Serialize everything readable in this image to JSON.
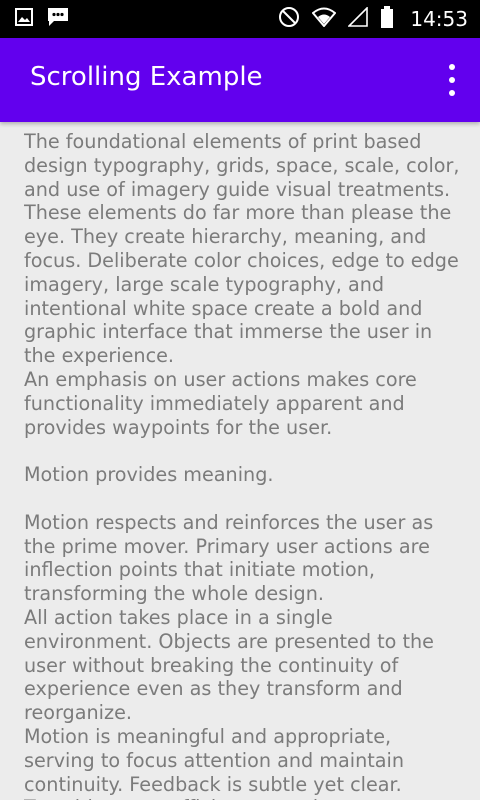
{
  "status_bar": {
    "time": "14:53",
    "left_icons": [
      "image-icon",
      "message-icon"
    ],
    "right_icons": [
      "do-not-disturb-icon",
      "wifi-icon",
      "signal-icon",
      "battery-icon"
    ]
  },
  "app_bar": {
    "title": "Scrolling Example",
    "menu_icon": "more-vert-icon",
    "background": "#6200ee"
  },
  "content": {
    "text": " The foundational elements of print based design typography, grids, space, scale, color, and use of imagery guide visual treatments. These elements do far more than please the eye. They create hierarchy, meaning, and focus. Deliberate color choices, edge to edge imagery, large scale typography, and intentional white space create a bold and graphic  interface that immerse the user in the experience.\n An emphasis on user actions makes core functionality immediately apparent and provides  waypoints for the user.\n\n Motion provides meaning.\n\n Motion respects and reinforces the user as the prime mover. Primary user actions are inflection points that initiate motion, transforming the whole design.\n All action takes place in a single environment. Objects are presented to the user without breaking the continuity of experience even as they transform and reorganize.\n Motion is meaningful and appropriate, serving to focus attention and maintain continuity. Feedback is subtle yet clear. Transitions are efficient yet coherent."
  }
}
